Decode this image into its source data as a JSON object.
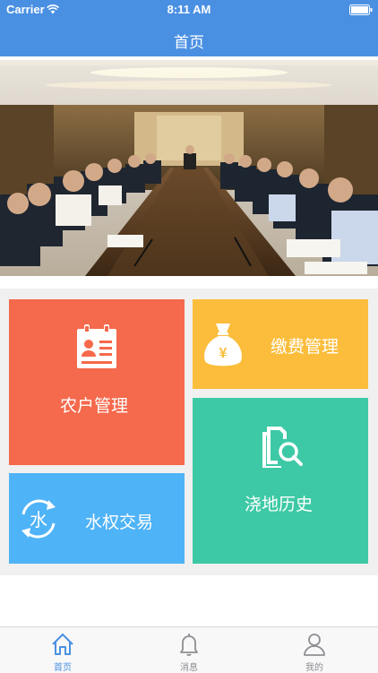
{
  "status_bar": {
    "carrier": "Carrier",
    "time": "8:11 AM"
  },
  "header": {
    "title": "首页"
  },
  "tiles": {
    "farmer": "农户管理",
    "fee": "缴费管理",
    "water": "水权交易",
    "water_icon_char": "水",
    "fee_icon_char": "¥",
    "history": "浇地历史"
  },
  "tabs": [
    {
      "label": "首页",
      "icon": "home-icon",
      "active": true
    },
    {
      "label": "消息",
      "icon": "bell-icon",
      "active": false
    },
    {
      "label": "我的",
      "icon": "user-icon",
      "active": false
    }
  ],
  "colors": {
    "primary": "#4a90e2",
    "farmer_tile": "#f5694c",
    "fee_tile": "#fbbd3b",
    "water_tile": "#4fb3f7",
    "history_tile": "#3dc9a5"
  }
}
